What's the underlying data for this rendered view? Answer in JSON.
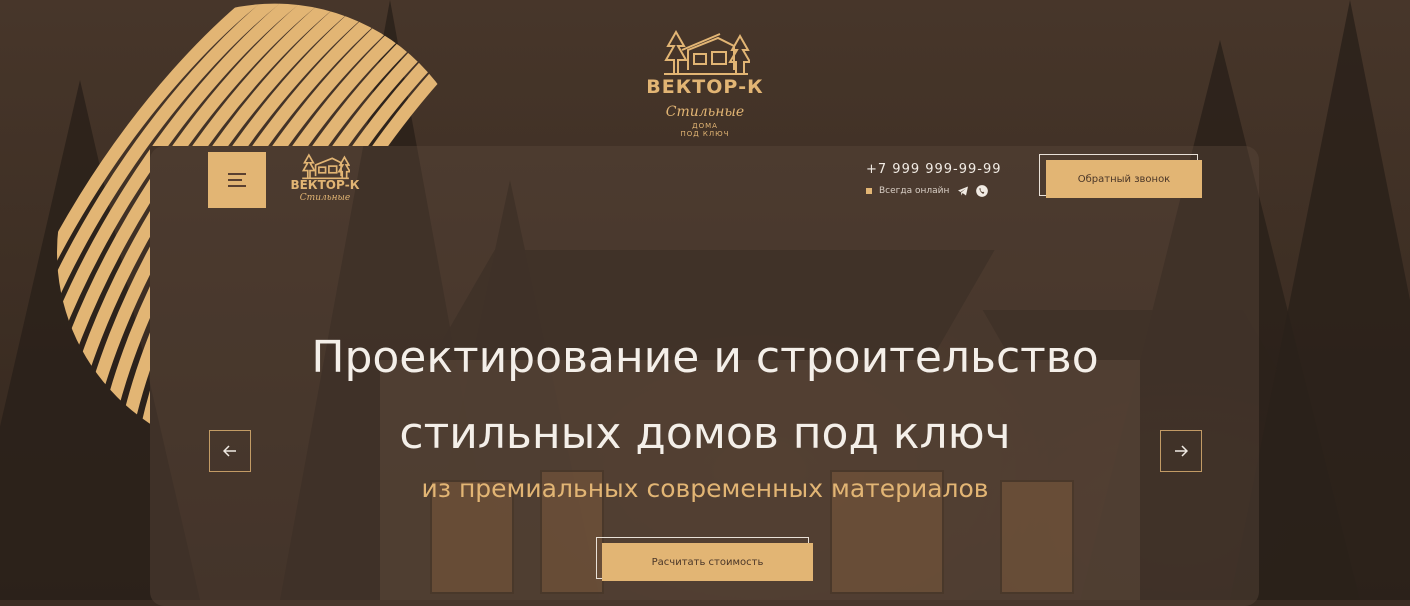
{
  "brand": {
    "name": "ВЕКТОР-К",
    "script": "Стильные",
    "tagline_line1": "ДОМА",
    "tagline_line2": "ПОД КЛЮЧ"
  },
  "header": {
    "menu_icon": "hamburger-menu-icon",
    "phone": "+7 999 999-99-99",
    "online_status": "Всегда онлайн",
    "social_icons": [
      "telegram-icon",
      "whatsapp-icon"
    ],
    "callback_button": "Обратный звонок"
  },
  "hero": {
    "title_line1": "Проектирование и строительство",
    "title_line2": "стильных домов под ключ",
    "subtitle": "из премиальных современных материалов",
    "cta_button": "Расчитать стоимость",
    "prev_icon": "arrow-left-icon",
    "next_icon": "arrow-right-icon"
  },
  "colors": {
    "accent": "#e2b574",
    "panel": "#5a483c",
    "text_light": "#f4efe9",
    "background": "#3b2c22"
  }
}
